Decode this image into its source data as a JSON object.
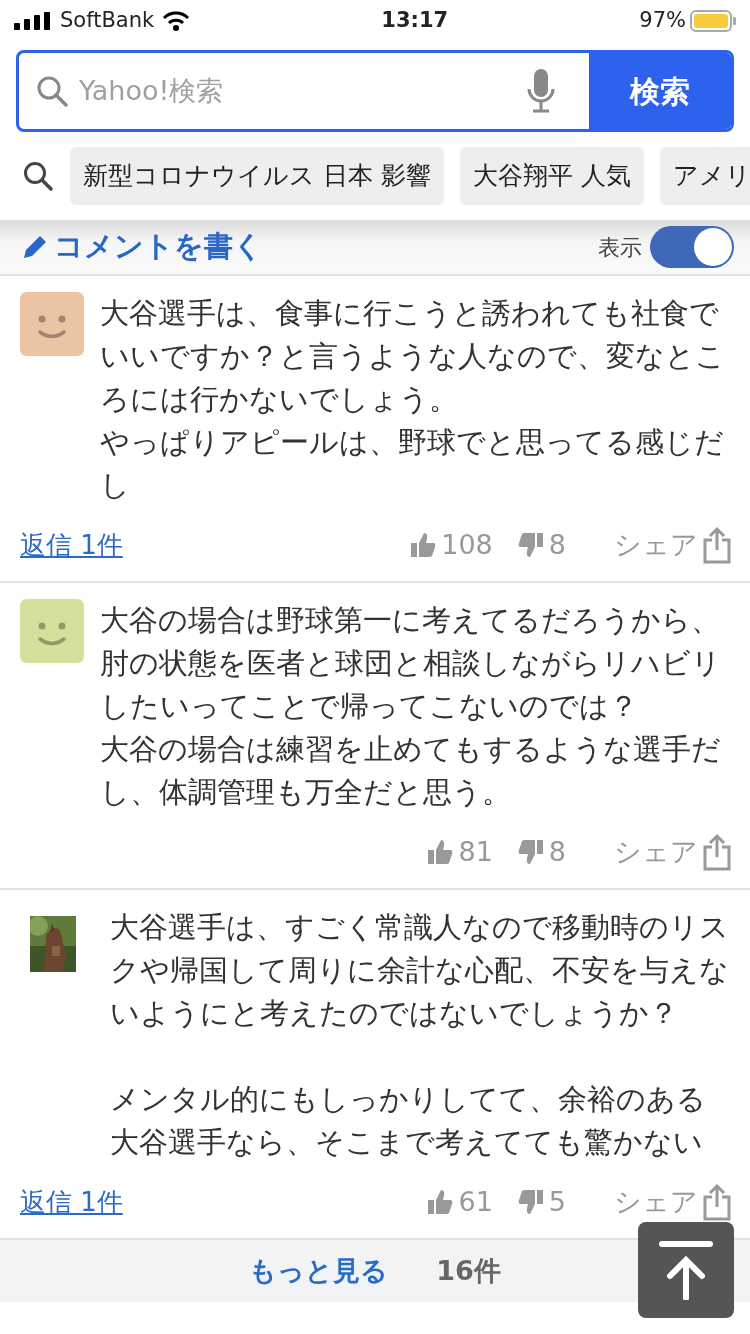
{
  "status_bar": {
    "carrier": "SoftBank",
    "time": "13:17",
    "battery": "97%"
  },
  "search": {
    "placeholder": "Yahoo!検索",
    "button": "検索"
  },
  "suggestions": [
    "新型コロナウイルス 日本 影響",
    "大谷翔平 人気",
    "アメリ"
  ],
  "comment_header": {
    "write_label": "コメントを書く",
    "toggle_label": "表示",
    "toggle_on": true
  },
  "comments": [
    {
      "kind": "smiley",
      "color": "#ebc4a4",
      "paragraphs": [
        "大谷選手は、食事に行こうと誘われても社食でいいですか？と言うような人なので、変なところには行かないでしょう。",
        "やっぱりアピールは、野球でと思ってる感じだし"
      ],
      "spaced": false,
      "reply": "返信 1件",
      "likes": "108",
      "dislikes": "8",
      "share": "シェア"
    },
    {
      "kind": "smiley",
      "color": "#d5e09c",
      "paragraphs": [
        "大谷の場合は野球第一に考えてるだろうから、肘の状態を医者と球団と相談しながらリハビリしたいってことで帰ってこないのでは？",
        "大谷の場合は練習を止めてもするような選手だし、体調管理も万全だと思う。"
      ],
      "spaced": false,
      "likes": "81",
      "dislikes": "8",
      "share": "シェア"
    },
    {
      "kind": "picture",
      "paragraphs": [
        "大谷選手は、すごく常識人なので移動時のリスクや帰国して周りに余計な心配、不安を与えないようにと考えたのではないでしょうか？",
        "メンタル的にもしっかりしてて、余裕のある大谷選手なら、そこまで考えてても驚かない"
      ],
      "spaced": true,
      "reply": "返信 1件",
      "likes": "61",
      "dislikes": "5",
      "share": "シェア"
    }
  ],
  "more": {
    "label": "もっと見る",
    "count": "16件"
  }
}
